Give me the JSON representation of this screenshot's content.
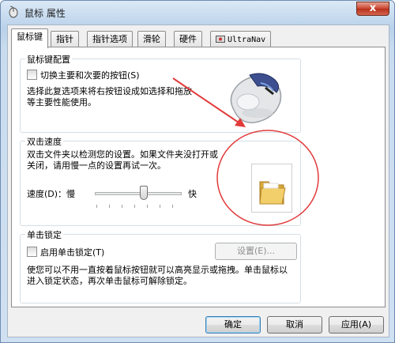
{
  "window": {
    "title": "鼠标 属性",
    "close_label": "x"
  },
  "tabs": [
    {
      "label": "鼠标键",
      "active": true
    },
    {
      "label": "指针"
    },
    {
      "label": "指针选项"
    },
    {
      "label": "滑轮"
    },
    {
      "label": "硬件"
    },
    {
      "label": "UltraNav",
      "icon": "ultranav-icon"
    }
  ],
  "button_config": {
    "title": "鼠标键配置",
    "switch_label": "切换主要和次要的按钮(S)",
    "switch_checked": false,
    "description": "选择此复选项来将右按钮设成如选择和拖放等主要性能使用。"
  },
  "double_click": {
    "title": "双击速度",
    "description": "双击文件夹以检测您的设置。如果文件夹没打开或关闭，请用慢一点的设置再试一次。",
    "speed_label": "速度(D)：慢",
    "fast_label": "快",
    "speed_value": 0.5
  },
  "click_lock": {
    "title": "单击锁定",
    "enable_label": "启用单击锁定(T)",
    "enable_checked": false,
    "settings_label": "设置(E)...",
    "description": "使您可以不用一直按着鼠标按钮就可以高亮显示或拖拽。单击鼠标以进入锁定状态，再次单击鼠标可解除锁定。"
  },
  "footer": {
    "ok_label": "确定",
    "cancel_label": "取消",
    "apply_label": "应用(A)"
  },
  "colors": {
    "annotation_red": "#e23b3b",
    "accent_blue": "#3c7fb1"
  }
}
